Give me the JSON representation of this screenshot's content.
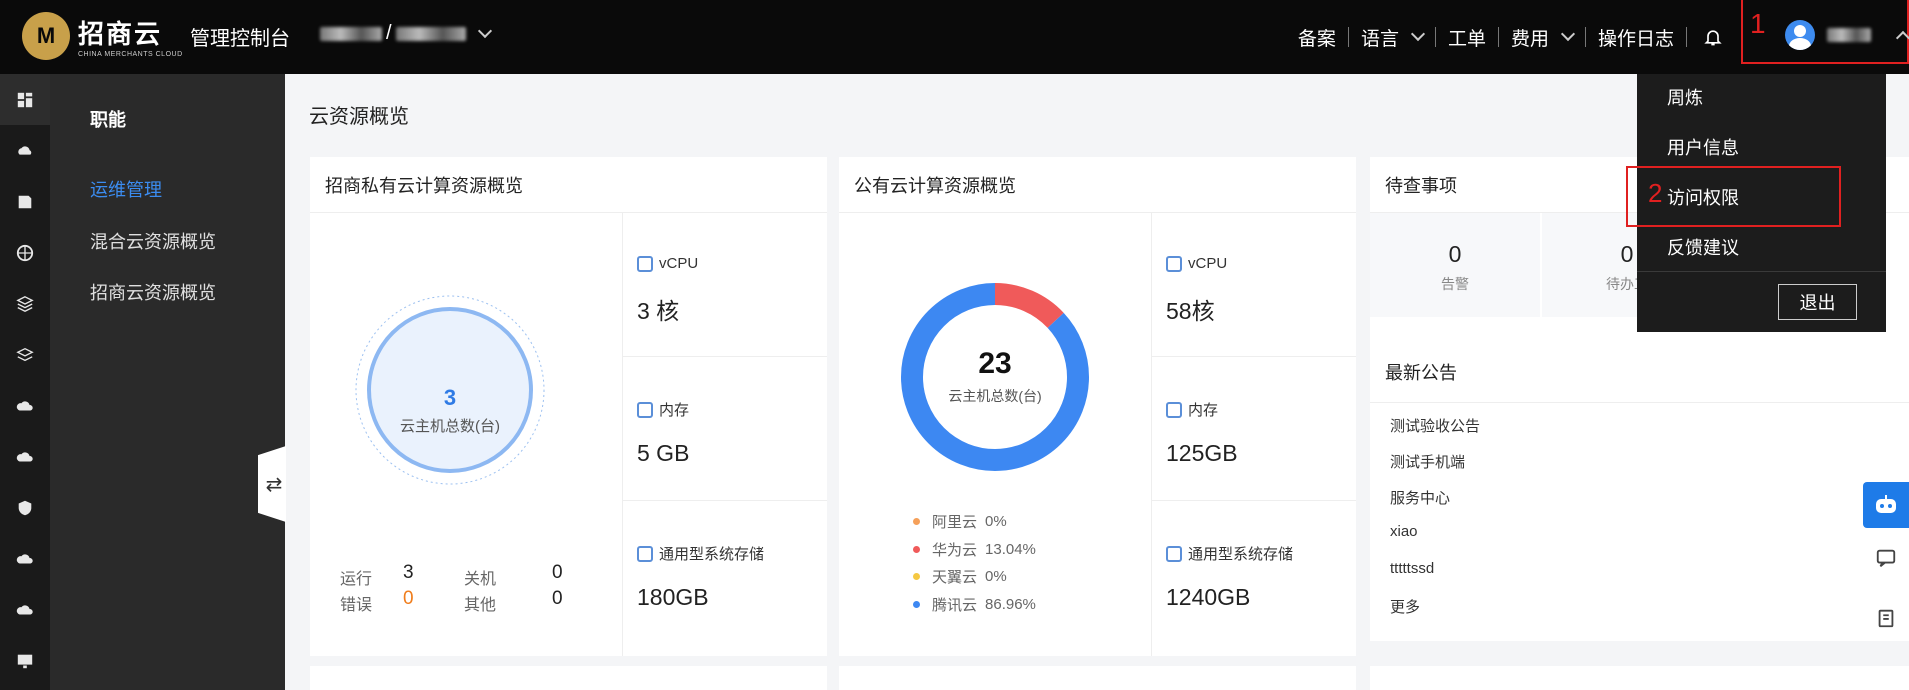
{
  "header": {
    "logo_cn": "招商云",
    "logo_en": "CHINA MERCHANTS CLOUD",
    "console_title": "管理控制台",
    "org_separator": "/",
    "nav": [
      {
        "label": "备案"
      },
      {
        "label": "语言"
      },
      {
        "label": "工单"
      },
      {
        "label": "费用"
      },
      {
        "label": "操作日志"
      }
    ],
    "annotation_1": "1"
  },
  "subnav": {
    "heading": "职能",
    "links": [
      "运维管理",
      "混合云资源概览",
      "招商云资源概览"
    ]
  },
  "collapse_icon": "⇄",
  "main": {
    "title": "云资源概览",
    "private_card": {
      "title": "招商私有云计算资源概览",
      "total": "3",
      "total_label": "云主机总数(台)",
      "status": [
        {
          "label": "运行",
          "value": "3"
        },
        {
          "label": "关机",
          "value": "0"
        },
        {
          "label": "错误",
          "value": "0"
        },
        {
          "label": "其他",
          "value": "0"
        }
      ],
      "stats": [
        {
          "label": "vCPU",
          "value": "3 核",
          "icon": "cpu-icon"
        },
        {
          "label": "内存",
          "value": "5 GB",
          "icon": "memory-icon"
        },
        {
          "label": "通用型系统存储",
          "value": "180GB",
          "icon": "storage-icon"
        }
      ]
    },
    "public_card": {
      "title": "公有云计算资源概览",
      "total": "23",
      "total_label": "云主机总数(台)",
      "legend": [
        {
          "name": "阿里云",
          "value": "0%",
          "color": "#f5a05a"
        },
        {
          "name": "华为云",
          "value": "13.04%",
          "color": "#f05a5a"
        },
        {
          "name": "天翼云",
          "value": "0%",
          "color": "#f5c842"
        },
        {
          "name": "腾讯云",
          "value": "86.96%",
          "color": "#3d88f2"
        }
      ],
      "share": [
        0,
        13.04,
        0,
        86.96
      ],
      "stats": [
        {
          "label": "vCPU",
          "value": "58核",
          "icon": "cpu-icon"
        },
        {
          "label": "内存",
          "value": "125GB",
          "icon": "memory-icon"
        },
        {
          "label": "通用型系统存储",
          "value": "1240GB",
          "icon": "storage-icon"
        }
      ]
    },
    "todo_card": {
      "title": "待查事项",
      "items": [
        {
          "value": "0",
          "label": "告警"
        },
        {
          "value": "0",
          "label": "待办工"
        }
      ]
    },
    "notice_card": {
      "title": "最新公告",
      "items": [
        "测试验收公告",
        "测试手机端",
        "服务中心",
        "xiao",
        "tttttssd",
        "更多"
      ]
    }
  },
  "dropdown": {
    "items": [
      "周炼",
      "用户信息",
      "访问权限",
      "反馈建议"
    ],
    "logout": "退出",
    "annotation_2": "2"
  },
  "colors": {
    "accent": "#3b8cf0",
    "annotation": "#e02020",
    "error_value": "#f07d1c"
  }
}
